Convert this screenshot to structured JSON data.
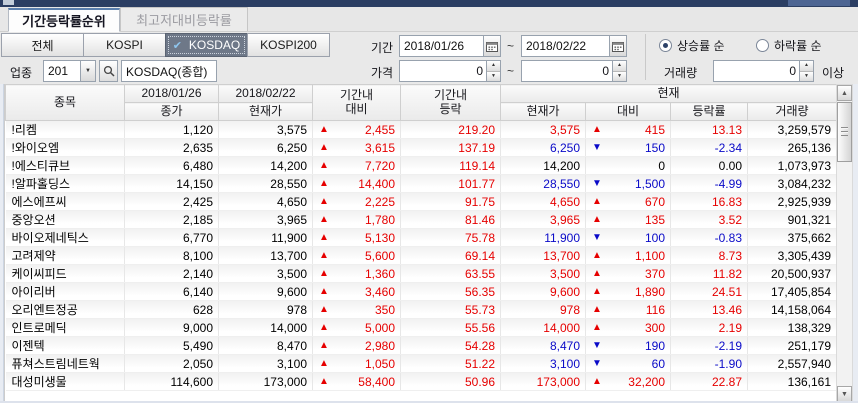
{
  "colors": {
    "up": "#e60000",
    "down": "#0a0ac8",
    "flat": "#000000",
    "accent_navy": "#2b3e63"
  },
  "icons": {
    "check": "✔",
    "combo_arrow": "▼",
    "spin_up": "▲",
    "spin_down": "▼",
    "scroll_up": "▲",
    "scroll_down": "▼",
    "arrow_up": "▲",
    "arrow_down": "▼"
  },
  "tabs": [
    {
      "label": "기간등락률순위",
      "active": true
    },
    {
      "label": "최고저대비등락률",
      "active": false
    }
  ],
  "filters": {
    "market_buttons": [
      {
        "label": "전체"
      },
      {
        "label": "KOSPI"
      },
      {
        "label": "KOSDAQ",
        "selected": true
      },
      {
        "label": "KOSPI200"
      }
    ],
    "period": {
      "label": "기간",
      "from": "2018/01/26",
      "to": "2018/02/22",
      "tilde": "~"
    },
    "sort": {
      "options": [
        {
          "label": "상승률 순",
          "selected": true
        },
        {
          "label": "하락률 순",
          "selected": false
        }
      ]
    },
    "sector": {
      "label": "업종",
      "code": "201",
      "name": "KOSDAQ(종합)"
    },
    "price": {
      "label": "가격",
      "from": "0",
      "to": "0",
      "tilde": "~"
    },
    "volume": {
      "label": "거래량",
      "value": "0",
      "suffix": "이상"
    }
  },
  "table": {
    "header": {
      "stock": "종목",
      "date_from": "2018/01/26",
      "sub_close": "종가",
      "date_to": "2018/02/22",
      "sub_price": "현재가",
      "period_diff": [
        "기간내",
        "대비"
      ],
      "period_rate": [
        "기간내",
        "등락"
      ],
      "current_group": "현재",
      "sub_cur_price": "현재가",
      "sub_diff": "대비",
      "sub_rate": "등락률",
      "sub_volume": "거래량"
    },
    "rows": [
      {
        "name": "!리켐",
        "close": "1,120",
        "price": "3,575",
        "period_sign": "up",
        "diff": "2,455",
        "rate": "219.20",
        "cur_price": "3,575",
        "sign": "up",
        "cur_diff": "415",
        "cur_rate": "13.13",
        "volume": "3,259,579"
      },
      {
        "name": "!와이오엠",
        "close": "2,635",
        "price": "6,250",
        "period_sign": "up",
        "diff": "3,615",
        "rate": "137.19",
        "cur_price": "6,250",
        "sign": "down",
        "cur_diff": "150",
        "cur_rate": "-2.34",
        "volume": "265,136"
      },
      {
        "name": "!에스티큐브",
        "close": "6,480",
        "price": "14,200",
        "period_sign": "up",
        "diff": "7,720",
        "rate": "119.14",
        "cur_price": "14,200",
        "sign": "flat",
        "cur_diff": "0",
        "cur_rate": "0.00",
        "volume": "1,073,973"
      },
      {
        "name": "!알파홀딩스",
        "close": "14,150",
        "price": "28,550",
        "period_sign": "up",
        "diff": "14,400",
        "rate": "101.77",
        "cur_price": "28,550",
        "sign": "down",
        "cur_diff": "1,500",
        "cur_rate": "-4.99",
        "volume": "3,084,232"
      },
      {
        "name": "에스에프씨",
        "close": "2,425",
        "price": "4,650",
        "period_sign": "up",
        "diff": "2,225",
        "rate": "91.75",
        "cur_price": "4,650",
        "sign": "up",
        "cur_diff": "670",
        "cur_rate": "16.83",
        "volume": "2,925,939"
      },
      {
        "name": "중앙오션",
        "close": "2,185",
        "price": "3,965",
        "period_sign": "up",
        "diff": "1,780",
        "rate": "81.46",
        "cur_price": "3,965",
        "sign": "up",
        "cur_diff": "135",
        "cur_rate": "3.52",
        "volume": "901,321"
      },
      {
        "name": "바이오제네틱스",
        "close": "6,770",
        "price": "11,900",
        "period_sign": "up",
        "diff": "5,130",
        "rate": "75.78",
        "cur_price": "11,900",
        "sign": "down",
        "cur_diff": "100",
        "cur_rate": "-0.83",
        "volume": "375,662"
      },
      {
        "name": "고려제약",
        "close": "8,100",
        "price": "13,700",
        "period_sign": "up",
        "diff": "5,600",
        "rate": "69.14",
        "cur_price": "13,700",
        "sign": "up",
        "cur_diff": "1,100",
        "cur_rate": "8.73",
        "volume": "3,305,439"
      },
      {
        "name": "케이씨피드",
        "close": "2,140",
        "price": "3,500",
        "period_sign": "up",
        "diff": "1,360",
        "rate": "63.55",
        "cur_price": "3,500",
        "sign": "up",
        "cur_diff": "370",
        "cur_rate": "11.82",
        "volume": "20,500,937"
      },
      {
        "name": "아이리버",
        "close": "6,140",
        "price": "9,600",
        "period_sign": "up",
        "diff": "3,460",
        "rate": "56.35",
        "cur_price": "9,600",
        "sign": "up",
        "cur_diff": "1,890",
        "cur_rate": "24.51",
        "volume": "17,405,854"
      },
      {
        "name": "오리엔트정공",
        "close": "628",
        "price": "978",
        "period_sign": "up",
        "diff": "350",
        "rate": "55.73",
        "cur_price": "978",
        "sign": "up",
        "cur_diff": "116",
        "cur_rate": "13.46",
        "volume": "14,158,064"
      },
      {
        "name": "인트로메딕",
        "close": "9,000",
        "price": "14,000",
        "period_sign": "up",
        "diff": "5,000",
        "rate": "55.56",
        "cur_price": "14,000",
        "sign": "up",
        "cur_diff": "300",
        "cur_rate": "2.19",
        "volume": "138,329"
      },
      {
        "name": "이젠텍",
        "close": "5,490",
        "price": "8,470",
        "period_sign": "up",
        "diff": "2,980",
        "rate": "54.28",
        "cur_price": "8,470",
        "sign": "down",
        "cur_diff": "190",
        "cur_rate": "-2.19",
        "volume": "251,179"
      },
      {
        "name": "퓨쳐스트림네트웍",
        "close": "2,050",
        "price": "3,100",
        "period_sign": "up",
        "diff": "1,050",
        "rate": "51.22",
        "cur_price": "3,100",
        "sign": "down",
        "cur_diff": "60",
        "cur_rate": "-1.90",
        "volume": "2,557,940"
      },
      {
        "name": "대성미생물",
        "close": "114,600",
        "price": "173,000",
        "period_sign": "up",
        "diff": "58,400",
        "rate": "50.96",
        "cur_price": "173,000",
        "sign": "up",
        "cur_diff": "32,200",
        "cur_rate": "22.87",
        "volume": "136,161"
      }
    ]
  }
}
